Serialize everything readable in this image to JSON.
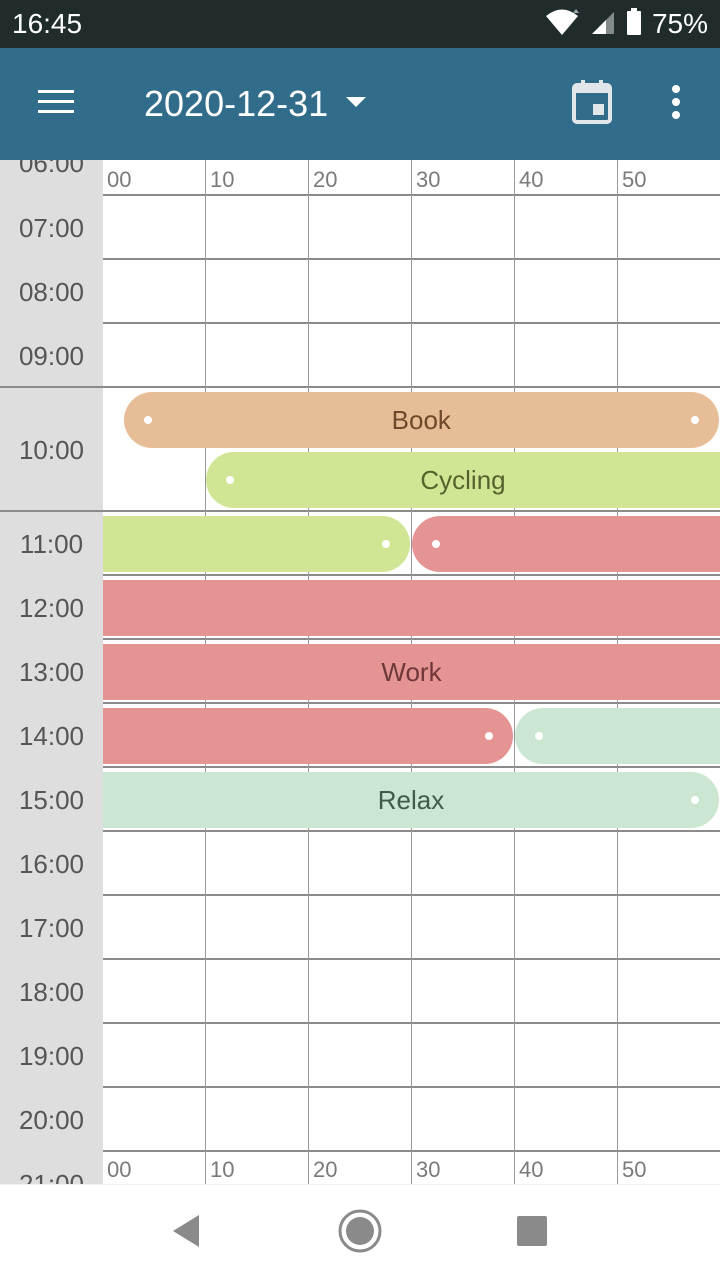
{
  "status_bar": {
    "time": "16:45",
    "battery": "75%",
    "icons": [
      "wifi-icon",
      "cell-signal-icon",
      "battery-icon"
    ]
  },
  "app_bar": {
    "date": "2020-12-31",
    "icons": [
      "menu-icon",
      "dropdown-arrow-icon",
      "calendar-icon",
      "more-vert-icon"
    ]
  },
  "minute_labels": [
    "00",
    "10",
    "20",
    "30",
    "40",
    "50"
  ],
  "hours": [
    "06:00",
    "07:00",
    "08:00",
    "09:00",
    "10:00",
    "11:00",
    "12:00",
    "13:00",
    "14:00",
    "15:00",
    "16:00",
    "17:00",
    "18:00",
    "19:00",
    "20:00",
    "21:00"
  ],
  "activities": [
    {
      "name": "Book",
      "color": "#e6bd96",
      "text_color": "#6d4a2c",
      "start": "10:02",
      "end": "10:59"
    },
    {
      "name": "Cycling",
      "color": "#d1e695",
      "text_color": "#55622c",
      "start": "10:10",
      "end": "11:29"
    },
    {
      "name": "Work",
      "color": "#e59494",
      "text_color": "#6e3838",
      "start": "11:30",
      "end": "14:39"
    },
    {
      "name": "Relax",
      "color": "#cbe6d1",
      "text_color": "#3e5c46",
      "start": "14:40",
      "end": "15:59"
    }
  ],
  "nav_bar": {
    "icons": [
      "back-icon",
      "home-icon",
      "recents-icon"
    ]
  }
}
